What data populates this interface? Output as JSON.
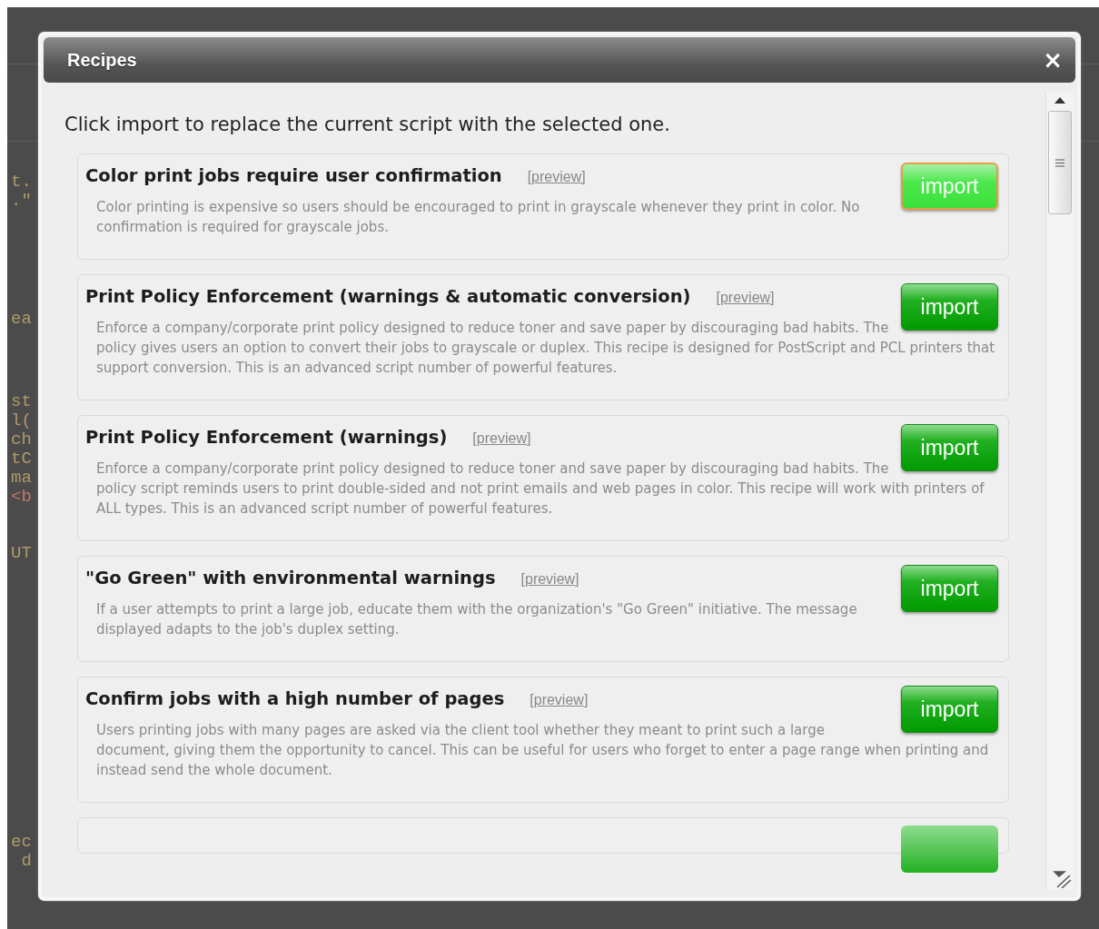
{
  "background_code": [
    [
      "t.",
      ".\""
    ],
    [
      "ea"
    ],
    [
      "st",
      "l(",
      "ch",
      "tC",
      "ma",
      "<b"
    ],
    [
      "UT"
    ],
    [
      "ec",
      " d"
    ]
  ],
  "dialog": {
    "title": "Recipes",
    "close": "×",
    "intro": "Click import to replace the current script with the selected one.",
    "recipes": [
      {
        "title": "Color print jobs require user confirmation",
        "preview": "[preview]",
        "button": "import",
        "selected": true,
        "description": "Color printing is expensive so users should be encouraged to print in grayscale whenever they print in color. No confirmation is required for grayscale jobs."
      },
      {
        "title": "Print Policy Enforcement (warnings & automatic conversion)",
        "preview": "[preview]",
        "button": "import",
        "selected": false,
        "description": "Enforce a company/corporate print policy designed to reduce toner and save paper by discouraging bad habits. The policy gives users an option to convert their jobs to grayscale or duplex. This recipe is designed for PostScript and PCL printers that support conversion. This is an advanced script number of powerful features."
      },
      {
        "title": "Print Policy Enforcement (warnings)",
        "preview": "[preview]",
        "button": "import",
        "selected": false,
        "description": "Enforce a company/corporate print policy designed to reduce toner and save paper by discouraging bad habits. The policy script reminds users to print double-sided and not print emails and web pages in color. This recipe will work with printers of ALL types. This is an advanced script number of powerful features."
      },
      {
        "title": "\"Go Green\" with environmental warnings",
        "preview": "[preview]",
        "button": "import",
        "selected": false,
        "description": "If a user attempts to print a large job, educate them with the organization's \"Go Green\" initiative. The message displayed adapts to the job's duplex setting."
      },
      {
        "title": "Confirm jobs with a high number of pages",
        "preview": "[preview]",
        "button": "import",
        "selected": false,
        "description": "Users printing jobs with many pages are asked via the client tool whether they meant to print such a large document, giving them the opportunity to cancel. This can be useful for users who forget to enter a page range when printing and instead send the whole document."
      }
    ],
    "more_below": true
  }
}
